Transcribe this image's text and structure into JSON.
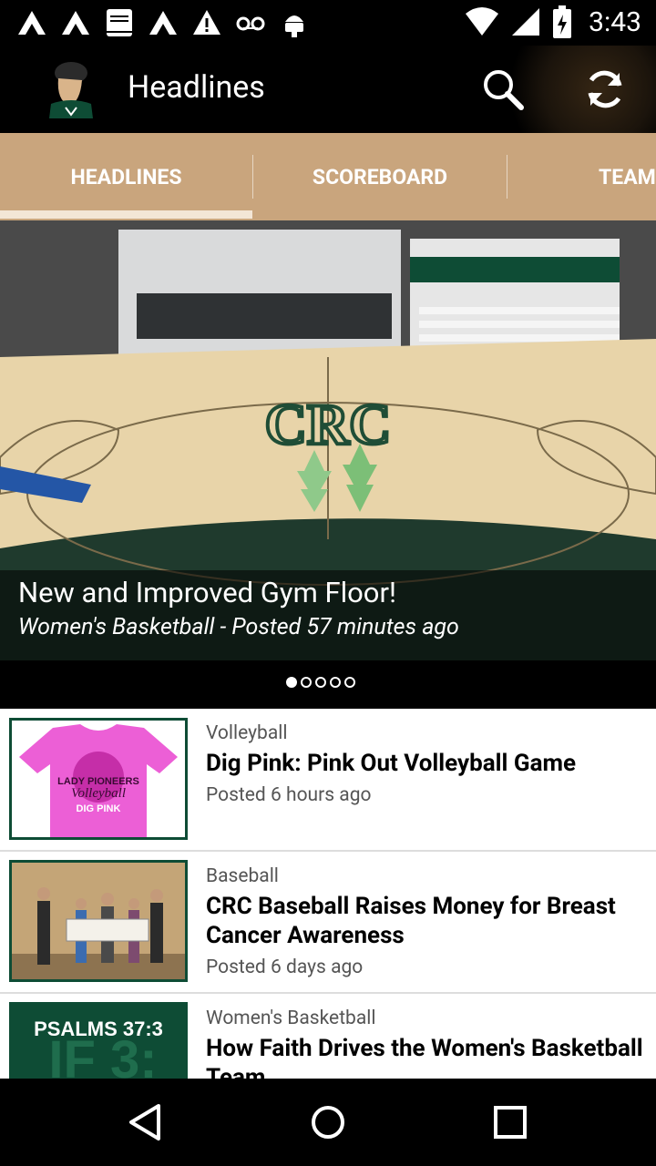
{
  "status_bar": {
    "time": "3:43",
    "notification_icons": [
      "app-a-icon",
      "app-a-icon",
      "bible-icon",
      "app-a-icon",
      "warning-icon",
      "voicemail-icon",
      "android-icon"
    ],
    "system_icons": [
      "wifi-icon",
      "signal-icon",
      "battery-icon"
    ]
  },
  "app_bar": {
    "title": "Headlines",
    "logo_icon": "pioneer-logo-icon",
    "actions": [
      "search-icon",
      "refresh-icon"
    ]
  },
  "tabs": [
    {
      "label": "HEADLINES",
      "selected": true
    },
    {
      "label": "SCOREBOARD",
      "selected": false
    },
    {
      "label": "TEAMS",
      "selected": false
    }
  ],
  "hero": {
    "title": "New and Improved Gym Floor!",
    "subtitle": "Women's Basketball - Posted 57 minutes ago",
    "floor_text": "CRC",
    "page_count": 5,
    "active_index": 0
  },
  "articles": [
    {
      "category": "Volleyball",
      "headline": "Dig Pink: Pink Out Volleyball Game",
      "posted": "Posted 6 hours ago",
      "thumb_text": "LADY PIONEERS Volleyball DIG PINK"
    },
    {
      "category": "Baseball",
      "headline": "CRC Baseball Raises Money for Breast Cancer Awareness",
      "posted": "Posted 6 days ago",
      "thumb_text": ""
    },
    {
      "category": "Women's Basketball",
      "headline": "How Faith Drives the Women's Basketball Team",
      "posted": "",
      "thumb_text": "PSALMS 37:3"
    }
  ],
  "nav": {
    "buttons": [
      "back-icon",
      "home-icon",
      "recents-icon"
    ]
  },
  "colors": {
    "tab_bar": "#c9a57d",
    "brand_green": "#0e4c35",
    "app_bar": "#000000"
  }
}
